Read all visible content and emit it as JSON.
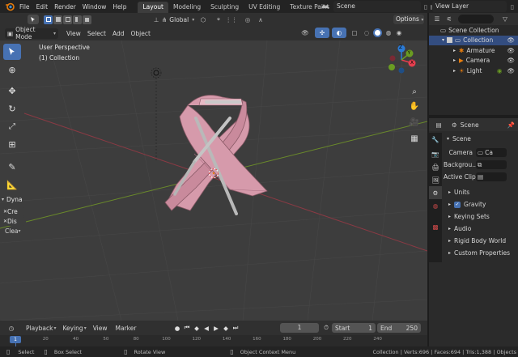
{
  "topbar": {
    "menus": [
      "File",
      "Edit",
      "Render",
      "Window",
      "Help"
    ],
    "workspace_tabs": [
      "Layout",
      "Modeling",
      "Sculpting",
      "UV Editing",
      "Texture Paint",
      "Sh"
    ],
    "active_tab": "Layout",
    "scene_label": "Scene",
    "view_layer_label": "View Layer"
  },
  "viewport_header": {
    "mode": "Object Mode",
    "menus": [
      "View",
      "Select",
      "Add",
      "Object"
    ],
    "orientation": "Global",
    "options_label": "Options"
  },
  "viewport": {
    "perspective_label": "User Perspective",
    "collection_label": "(1) Collection",
    "gizmo_axes": [
      "Z",
      "Y",
      "X"
    ],
    "axis_colors": {
      "x": "#e63e4e",
      "y": "#6a9c22",
      "z": "#2b7bd6"
    }
  },
  "operator_panel": {
    "title": "Dyna",
    "items": [
      "Cre",
      "Dis",
      "Clea"
    ]
  },
  "outliner": {
    "root": "Scene Collection",
    "collection": "Collection",
    "objects": [
      "Armature",
      "Camera",
      "Light"
    ]
  },
  "properties": {
    "context": "Scene",
    "panel_title": "Scene",
    "camera_label": "Camera",
    "camera_value": "Ca",
    "background_label": "Backgrou...",
    "active_clip_label": "Active Clip",
    "sections": [
      "Units",
      "Gravity",
      "Keying Sets",
      "Audio",
      "Rigid Body World",
      "Custom Properties"
    ],
    "gravity_checked": true
  },
  "timeline": {
    "menus": [
      "Playback",
      "Keying",
      "View",
      "Marker"
    ],
    "current_frame": "1",
    "start_label": "Start",
    "start_value": "1",
    "end_label": "End",
    "end_value": "250",
    "ticks": [
      "1",
      "20",
      "40",
      "50",
      "80",
      "100",
      "120",
      "140",
      "160",
      "180",
      "200",
      "220",
      "240"
    ],
    "playhead_label": "1"
  },
  "statusbar": {
    "select": "Select",
    "box_select": "Box Select",
    "rotate_view": "Rotate View",
    "context_menu": "Object Context Menu",
    "stats": "Collection | Verts:696 | Faces:694 | Tris:1,388 | Objects"
  }
}
